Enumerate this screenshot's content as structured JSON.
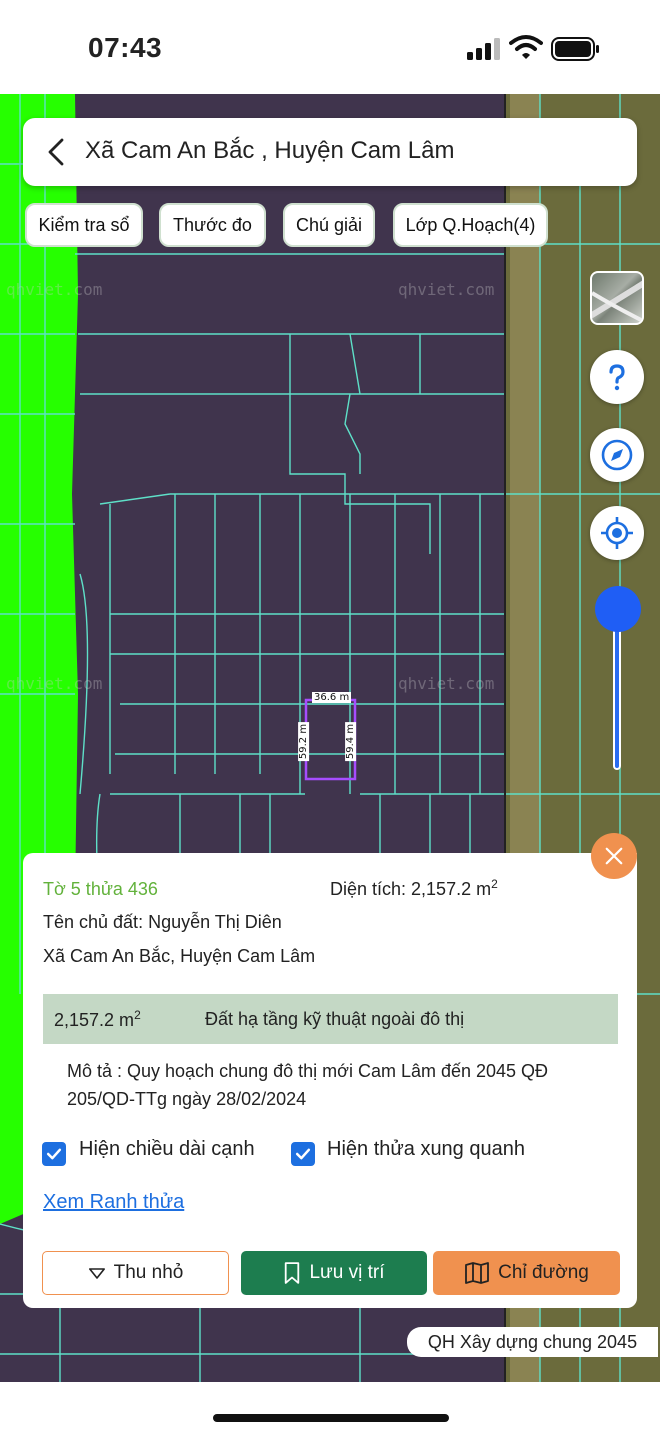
{
  "status_bar": {
    "time": "07:43"
  },
  "header": {
    "location_title": "Xã Cam An Bắc , Huyện Cam Lâm"
  },
  "toolbar": {
    "chips": [
      "Kiểm tra sổ",
      "Thước đo",
      "Chú giải",
      "Lớp Q.Hoạch(4)"
    ]
  },
  "map": {
    "watermark": "qhviet.com",
    "parcel": {
      "top_length": "36.6 m",
      "left_length": "59.2 m",
      "right_length": "59.4 m"
    },
    "colors": {
      "zone": "#40344d",
      "green_zone": "#26ff00",
      "parcel_lines": "#5ee0c8",
      "selected_parcel": "#a64dff"
    },
    "zoom_level": 0.0
  },
  "panel": {
    "parcel_id": "Tờ 5 thửa 436",
    "area_label": "Diện tích: 2,157.2 m",
    "area_unit_exp": "2",
    "owner": "Tên chủ đất: Nguyễn Thị Diên",
    "address": "Xã Cam An Bắc, Huyện Cam Lâm",
    "zone_area": "2,157.2 m",
    "zone_area_exp": "2",
    "zone_description": "Đất hạ tầng kỹ thuật ngoài đô thị",
    "description": "Mô tả : Quy hoạch chung đô thị mới Cam Lâm đến 2045 QĐ 205/QD-TTg ngày 28/02/2024",
    "show_edge_lengths": {
      "label": "Hiện chiều dài cạnh",
      "checked": true
    },
    "show_neighbors": {
      "label": "Hiện thửa xung quanh",
      "checked": true
    },
    "boundary_link": "Xem Ranh thửa",
    "buttons": {
      "collapse": "Thu nhỏ",
      "save": "Lưu vị trí",
      "directions": "Chỉ đường"
    }
  },
  "plan_badge": "QH Xây dựng chung 2045"
}
